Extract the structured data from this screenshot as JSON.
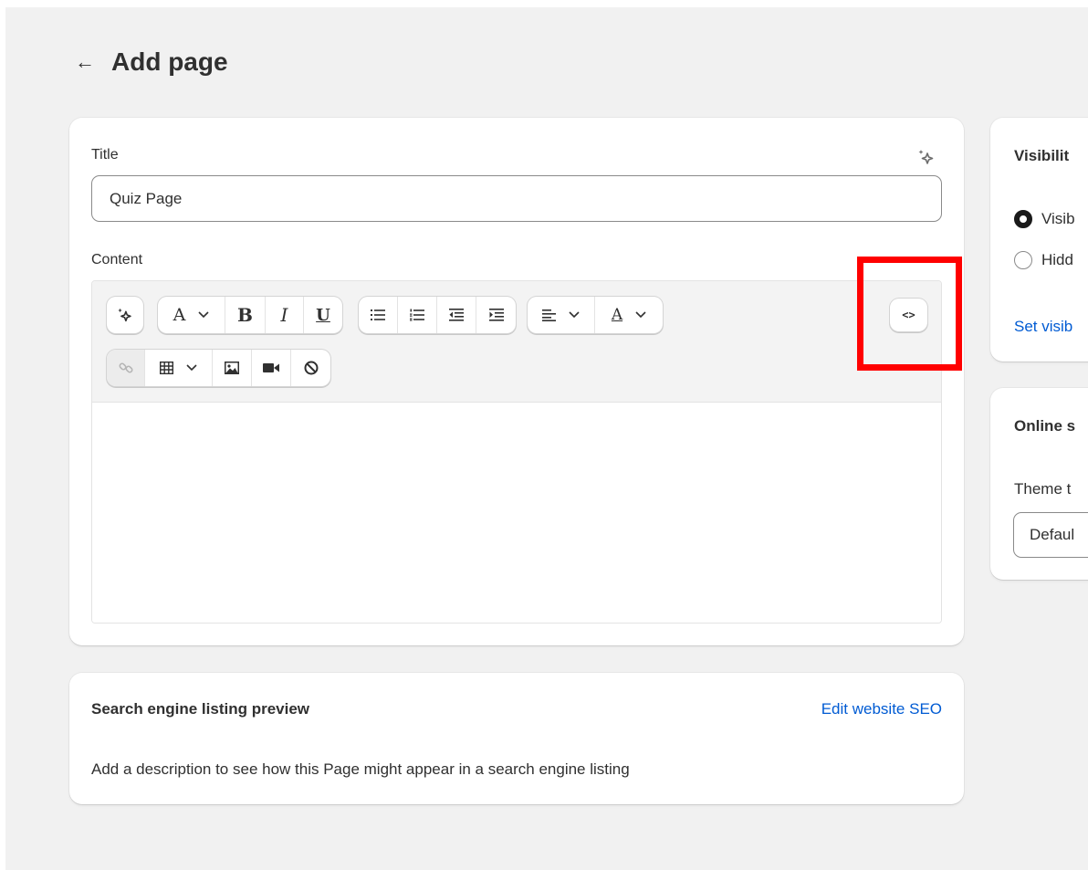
{
  "header": {
    "back_icon": "arrow-left-icon",
    "title": "Add page"
  },
  "main": {
    "title_label": "Title",
    "title_value": "Quiz Page",
    "content_label": "Content",
    "toolbar": {
      "font_label": "A",
      "bold_label": "B",
      "italic_label": "I",
      "underline_label": "U",
      "text_color_label": "A",
      "code_label": "<>"
    }
  },
  "seo": {
    "title": "Search engine listing preview",
    "edit_link": "Edit website SEO",
    "description": "Add a description to see how this Page might appear in a search engine listing"
  },
  "visibility": {
    "title": "Visibilit",
    "options": [
      {
        "label": "Visib",
        "selected": true
      },
      {
        "label": "Hidd",
        "selected": false
      }
    ],
    "set_link": "Set visib"
  },
  "online_store": {
    "title": "Online s",
    "theme_label": "Theme t",
    "theme_value": "Defaul"
  },
  "colors": {
    "link": "#005bd3",
    "highlight": "#ff0000",
    "background": "#f1f1f1"
  }
}
